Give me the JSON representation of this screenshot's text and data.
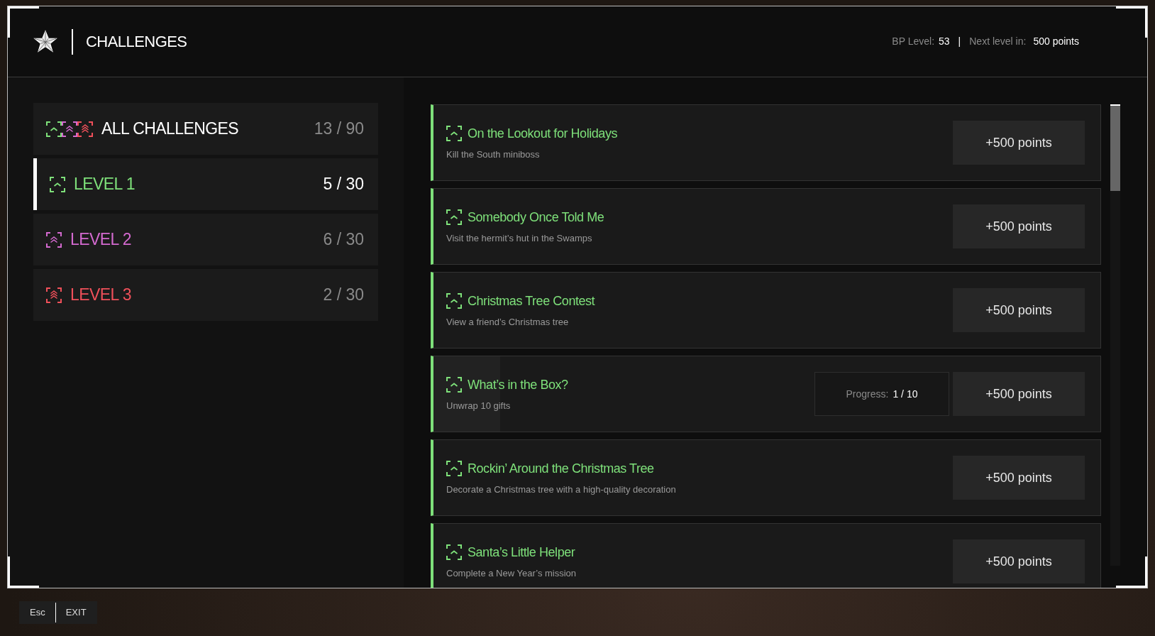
{
  "header": {
    "title": "CHALLENGES",
    "bp_label": "BP Level:",
    "bp_value": "53",
    "separator": "|",
    "next_label": "Next level in:",
    "next_value": "500 points"
  },
  "categories": [
    {
      "label": "ALL CHALLENGES",
      "count": "13 / 90",
      "color": "#ffffff",
      "selected": false,
      "icons": [
        {
          "kind": "single",
          "color": "#7ee07a"
        },
        {
          "kind": "double",
          "color": "#d46ad0"
        },
        {
          "kind": "triple",
          "color": "#f0505a"
        }
      ]
    },
    {
      "label": "LEVEL 1",
      "count": "5 / 30",
      "color": "#7ee07a",
      "selected": true,
      "icons": [
        {
          "kind": "single",
          "color": "#7ee07a"
        }
      ]
    },
    {
      "label": "LEVEL 2",
      "count": "6 / 30",
      "color": "#d46ad0",
      "selected": false,
      "icons": [
        {
          "kind": "double",
          "color": "#d46ad0"
        }
      ]
    },
    {
      "label": "LEVEL 3",
      "count": "2 / 30",
      "color": "#f0505a",
      "selected": false,
      "icons": [
        {
          "kind": "triple",
          "color": "#f0505a"
        }
      ]
    }
  ],
  "challenges": [
    {
      "title": "On the Lookout for Holidays",
      "description": "Kill the South miniboss",
      "reward": "+500 points"
    },
    {
      "title": "Somebody Once Told Me",
      "description": "Visit the hermit’s hut in the Swamps",
      "reward": "+500 points"
    },
    {
      "title": "Christmas Tree Contest",
      "description": "View a friend’s Christmas tree",
      "reward": "+500 points"
    },
    {
      "title": "What’s in the Box?",
      "description": "Unwrap 10 gifts",
      "reward": "+500 points",
      "progress": {
        "label": "Progress:",
        "value": "1 / 10",
        "level": 0.1
      }
    },
    {
      "title": "Rockin’ Around the Christmas Tree",
      "description": "Decorate a Christmas tree with a high-quality decoration",
      "reward": "+500 points"
    },
    {
      "title": "Santa’s Little Helper",
      "description": "Complete a New Year’s mission",
      "reward": "+500 points"
    }
  ],
  "exit": {
    "key": "Esc",
    "label": "EXIT"
  }
}
